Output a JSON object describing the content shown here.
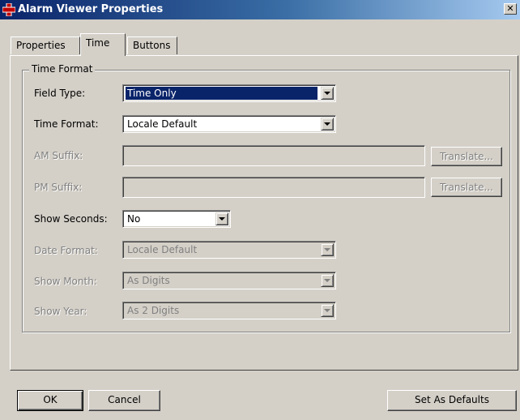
{
  "window": {
    "title": "Alarm Viewer Properties",
    "close_glyph": "✕"
  },
  "tabs": [
    {
      "label": "Properties",
      "active": false
    },
    {
      "label": "Time",
      "active": true
    },
    {
      "label": "Buttons",
      "active": false
    }
  ],
  "group": {
    "title": "Time Format"
  },
  "fields": {
    "field_type": {
      "label": "Field Type:",
      "value": "Time Only",
      "enabled": true
    },
    "time_format": {
      "label": "Time Format:",
      "value": "Locale Default",
      "enabled": true
    },
    "am_suffix": {
      "label": "AM Suffix:",
      "value": "",
      "enabled": false,
      "translate_label": "Translate..."
    },
    "pm_suffix": {
      "label": "PM Suffix:",
      "value": "",
      "enabled": false,
      "translate_label": "Translate..."
    },
    "show_seconds": {
      "label": "Show Seconds:",
      "value": "No",
      "enabled": true
    },
    "date_format": {
      "label": "Date Format:",
      "value": "Locale Default",
      "enabled": false
    },
    "show_month": {
      "label": "Show Month:",
      "value": "As Digits",
      "enabled": false
    },
    "show_year": {
      "label": "Show Year:",
      "value": "As 2 Digits",
      "enabled": false
    }
  },
  "buttons": {
    "ok": "OK",
    "cancel": "Cancel",
    "set_defaults": "Set As Defaults"
  },
  "colors": {
    "titlebar_start": "#0a246a",
    "titlebar_end": "#a6caf0",
    "face": "#d4d0c8",
    "selection": "#0a246a"
  }
}
